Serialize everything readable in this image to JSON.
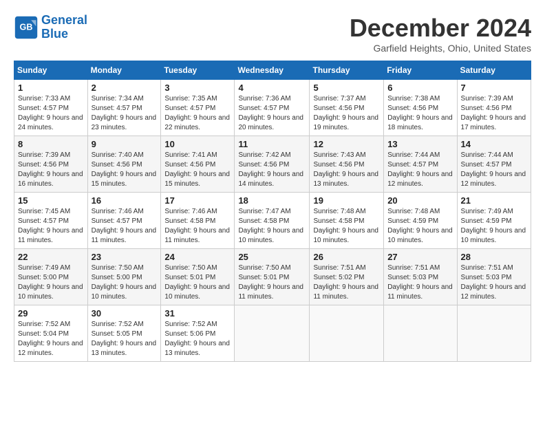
{
  "header": {
    "logo_line1": "General",
    "logo_line2": "Blue",
    "month_title": "December 2024",
    "location": "Garfield Heights, Ohio, United States"
  },
  "weekdays": [
    "Sunday",
    "Monday",
    "Tuesday",
    "Wednesday",
    "Thursday",
    "Friday",
    "Saturday"
  ],
  "weeks": [
    [
      {
        "day": "1",
        "sunrise": "7:33 AM",
        "sunset": "4:57 PM",
        "daylight": "9 hours and 24 minutes."
      },
      {
        "day": "2",
        "sunrise": "7:34 AM",
        "sunset": "4:57 PM",
        "daylight": "9 hours and 23 minutes."
      },
      {
        "day": "3",
        "sunrise": "7:35 AM",
        "sunset": "4:57 PM",
        "daylight": "9 hours and 22 minutes."
      },
      {
        "day": "4",
        "sunrise": "7:36 AM",
        "sunset": "4:57 PM",
        "daylight": "9 hours and 20 minutes."
      },
      {
        "day": "5",
        "sunrise": "7:37 AM",
        "sunset": "4:56 PM",
        "daylight": "9 hours and 19 minutes."
      },
      {
        "day": "6",
        "sunrise": "7:38 AM",
        "sunset": "4:56 PM",
        "daylight": "9 hours and 18 minutes."
      },
      {
        "day": "7",
        "sunrise": "7:39 AM",
        "sunset": "4:56 PM",
        "daylight": "9 hours and 17 minutes."
      }
    ],
    [
      {
        "day": "8",
        "sunrise": "7:39 AM",
        "sunset": "4:56 PM",
        "daylight": "9 hours and 16 minutes."
      },
      {
        "day": "9",
        "sunrise": "7:40 AM",
        "sunset": "4:56 PM",
        "daylight": "9 hours and 15 minutes."
      },
      {
        "day": "10",
        "sunrise": "7:41 AM",
        "sunset": "4:56 PM",
        "daylight": "9 hours and 15 minutes."
      },
      {
        "day": "11",
        "sunrise": "7:42 AM",
        "sunset": "4:56 PM",
        "daylight": "9 hours and 14 minutes."
      },
      {
        "day": "12",
        "sunrise": "7:43 AM",
        "sunset": "4:56 PM",
        "daylight": "9 hours and 13 minutes."
      },
      {
        "day": "13",
        "sunrise": "7:44 AM",
        "sunset": "4:57 PM",
        "daylight": "9 hours and 12 minutes."
      },
      {
        "day": "14",
        "sunrise": "7:44 AM",
        "sunset": "4:57 PM",
        "daylight": "9 hours and 12 minutes."
      }
    ],
    [
      {
        "day": "15",
        "sunrise": "7:45 AM",
        "sunset": "4:57 PM",
        "daylight": "9 hours and 11 minutes."
      },
      {
        "day": "16",
        "sunrise": "7:46 AM",
        "sunset": "4:57 PM",
        "daylight": "9 hours and 11 minutes."
      },
      {
        "day": "17",
        "sunrise": "7:46 AM",
        "sunset": "4:58 PM",
        "daylight": "9 hours and 11 minutes."
      },
      {
        "day": "18",
        "sunrise": "7:47 AM",
        "sunset": "4:58 PM",
        "daylight": "9 hours and 10 minutes."
      },
      {
        "day": "19",
        "sunrise": "7:48 AM",
        "sunset": "4:58 PM",
        "daylight": "9 hours and 10 minutes."
      },
      {
        "day": "20",
        "sunrise": "7:48 AM",
        "sunset": "4:59 PM",
        "daylight": "9 hours and 10 minutes."
      },
      {
        "day": "21",
        "sunrise": "7:49 AM",
        "sunset": "4:59 PM",
        "daylight": "9 hours and 10 minutes."
      }
    ],
    [
      {
        "day": "22",
        "sunrise": "7:49 AM",
        "sunset": "5:00 PM",
        "daylight": "9 hours and 10 minutes."
      },
      {
        "day": "23",
        "sunrise": "7:50 AM",
        "sunset": "5:00 PM",
        "daylight": "9 hours and 10 minutes."
      },
      {
        "day": "24",
        "sunrise": "7:50 AM",
        "sunset": "5:01 PM",
        "daylight": "9 hours and 10 minutes."
      },
      {
        "day": "25",
        "sunrise": "7:50 AM",
        "sunset": "5:01 PM",
        "daylight": "9 hours and 11 minutes."
      },
      {
        "day": "26",
        "sunrise": "7:51 AM",
        "sunset": "5:02 PM",
        "daylight": "9 hours and 11 minutes."
      },
      {
        "day": "27",
        "sunrise": "7:51 AM",
        "sunset": "5:03 PM",
        "daylight": "9 hours and 11 minutes."
      },
      {
        "day": "28",
        "sunrise": "7:51 AM",
        "sunset": "5:03 PM",
        "daylight": "9 hours and 12 minutes."
      }
    ],
    [
      {
        "day": "29",
        "sunrise": "7:52 AM",
        "sunset": "5:04 PM",
        "daylight": "9 hours and 12 minutes."
      },
      {
        "day": "30",
        "sunrise": "7:52 AM",
        "sunset": "5:05 PM",
        "daylight": "9 hours and 13 minutes."
      },
      {
        "day": "31",
        "sunrise": "7:52 AM",
        "sunset": "5:06 PM",
        "daylight": "9 hours and 13 minutes."
      },
      null,
      null,
      null,
      null
    ]
  ]
}
